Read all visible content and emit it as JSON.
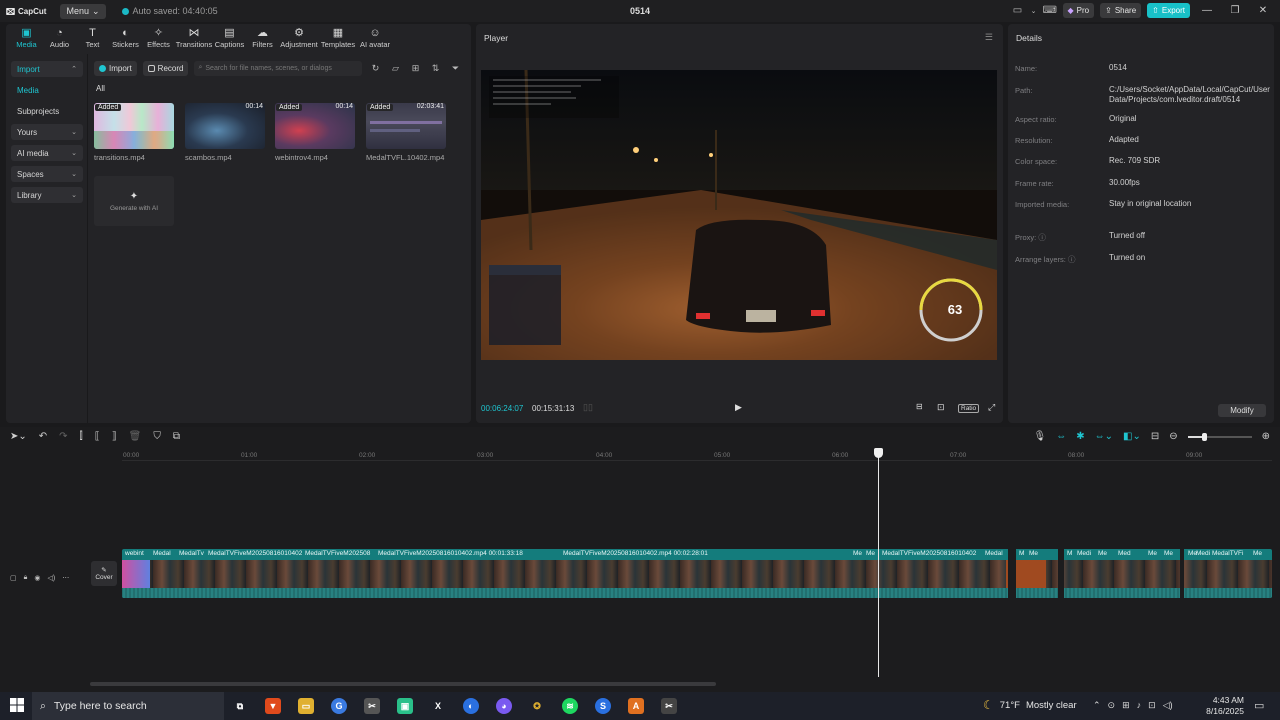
{
  "titlebar": {
    "brand": "CapCut",
    "menu": "Menu",
    "autosave": "Auto saved: 04:40:05",
    "title": "0514",
    "pro": "Pro",
    "share": "Share",
    "export": "Export",
    "accent": "#1fc5d0"
  },
  "tabs": [
    {
      "label": "Media",
      "icon": "media-icon",
      "active": true
    },
    {
      "label": "Audio",
      "icon": "audio-icon"
    },
    {
      "label": "Text",
      "icon": "text-icon"
    },
    {
      "label": "Stickers",
      "icon": "sticker-icon"
    },
    {
      "label": "Effects",
      "icon": "effects-icon"
    },
    {
      "label": "Transitions",
      "icon": "transitions-icon"
    },
    {
      "label": "Captions",
      "icon": "captions-icon"
    },
    {
      "label": "Filters",
      "icon": "filters-icon"
    },
    {
      "label": "Adjustment",
      "icon": "adjustment-icon"
    },
    {
      "label": "Templates",
      "icon": "templates-icon"
    },
    {
      "label": "AI avatar",
      "icon": "ai-avatar-icon"
    }
  ],
  "sidenav": {
    "import": "Import",
    "media": "Media",
    "subprojects": "Subprojects",
    "yours": "Yours",
    "ai_media": "AI media",
    "spaces": "Spaces",
    "library": "Library"
  },
  "media_toolbar": {
    "import": "Import",
    "record": "Record",
    "search_placeholder": "Search for file names, scenes, or dialogs"
  },
  "media": {
    "all_label": "All",
    "items": [
      {
        "name": "transitions.mp4",
        "badge": "Added",
        "duration": ""
      },
      {
        "name": "scambos.mp4",
        "badge": "",
        "duration": "00:14"
      },
      {
        "name": "webintrov4.mp4",
        "badge": "Added",
        "duration": "00:14"
      },
      {
        "name": "MedalTVFL.10402.mp4",
        "badge": "Added",
        "duration": "02:03:41"
      }
    ],
    "generate": "Generate with AI"
  },
  "player": {
    "title": "Player",
    "current": "00:06:24:07",
    "total": "00:15:31:13",
    "speed": "63",
    "ratio": "Ratio"
  },
  "details": {
    "title": "Details",
    "rows": [
      {
        "label": "Name:",
        "value": "0514"
      },
      {
        "label": "Path:",
        "value": "C:/Users/Socket/AppData/Local/CapCut/User Data/Projects/com.lveditor.draft/0514"
      },
      {
        "label": "Aspect ratio:",
        "value": "Original"
      },
      {
        "label": "Resolution:",
        "value": "Adapted"
      },
      {
        "label": "Color space:",
        "value": "Rec. 709 SDR"
      },
      {
        "label": "Frame rate:",
        "value": "30.00fps"
      },
      {
        "label": "Imported media:",
        "value": "Stay in original location"
      },
      {
        "label": "Proxy:",
        "value": "Turned off"
      },
      {
        "label": "Arrange layers:",
        "value": "Turned on"
      }
    ],
    "modify": "Modify"
  },
  "timeline": {
    "ruler": [
      "00:00",
      "01:00",
      "02:00",
      "03:00",
      "04:00",
      "05:00",
      "06:00",
      "07:00",
      "08:00",
      "09:00"
    ],
    "cover": "Cover",
    "clips": [
      "webint",
      "Medal",
      "MedalTv",
      "MedalTVFiveM20250816010402",
      "MedalTVFiveM202508",
      "MedalTVFiveM20250816010402.mp4  00:01:33:18",
      "MedalTVFiveM20250816010402.mp4  00:02:28:01",
      "Me",
      "Me",
      "MedalTVFiveM20250816010402",
      "Medal",
      "M",
      "Me",
      "M",
      "Medi",
      "Me",
      "Med",
      "Me",
      "Me",
      "Me",
      "Medi",
      "MedalTVFi",
      "Me"
    ]
  },
  "taskbar": {
    "search": "Type here to search",
    "weather_temp": "71°F",
    "weather_desc": "Mostly clear",
    "time": "4:43 AM",
    "date": "8/16/2025"
  }
}
